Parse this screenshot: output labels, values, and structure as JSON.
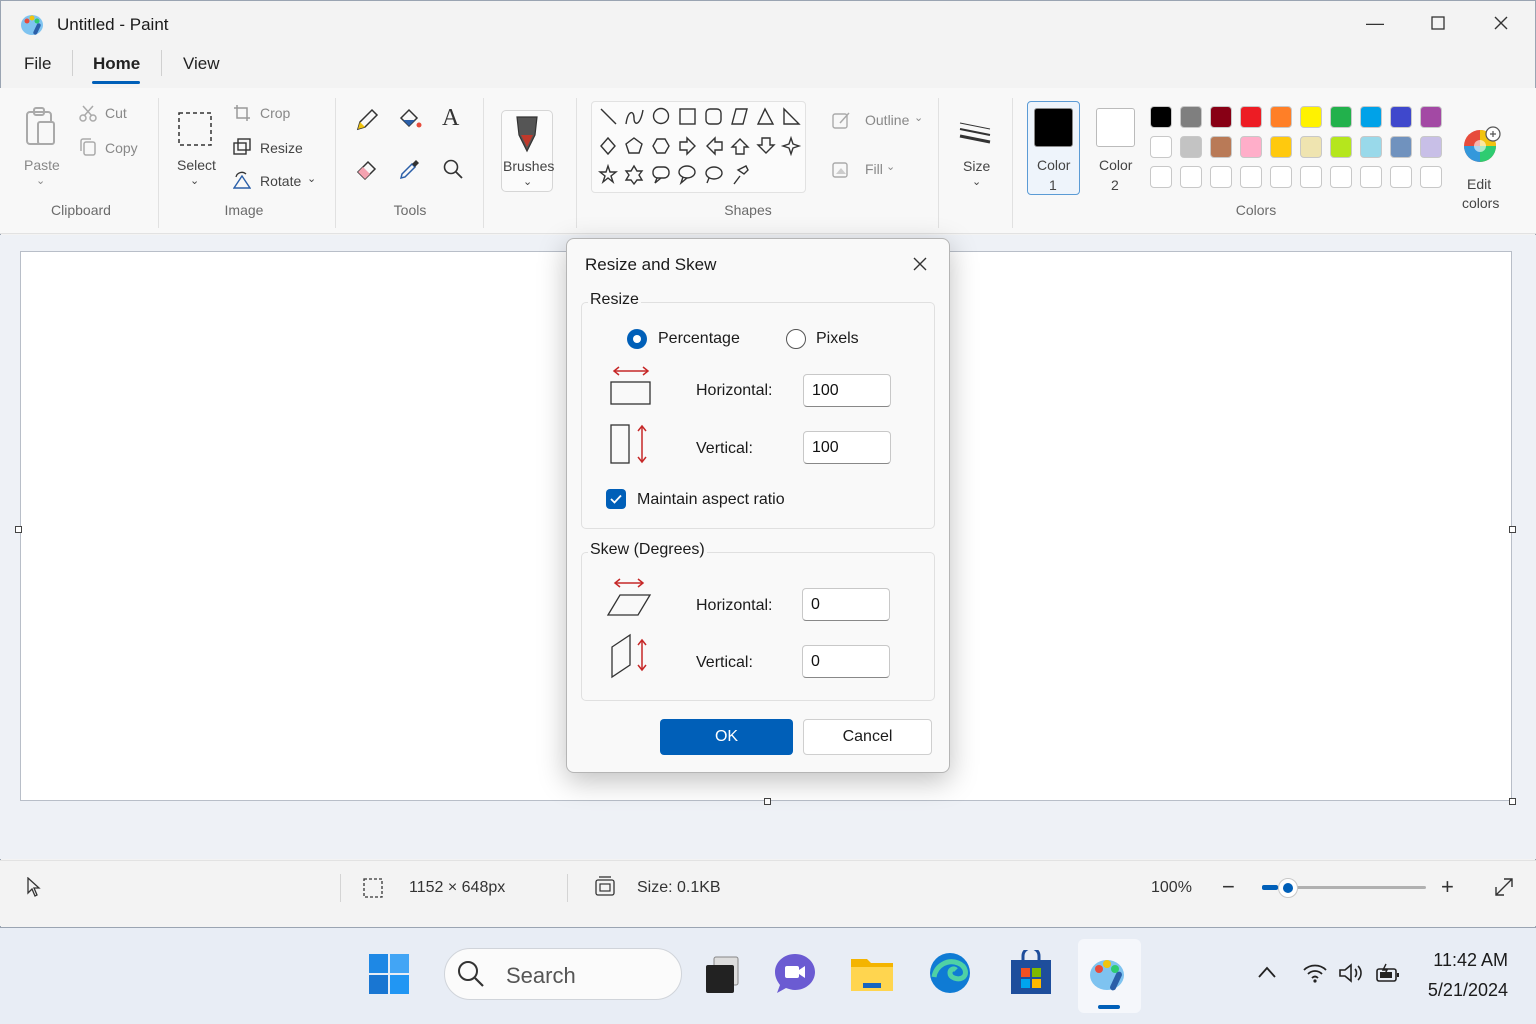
{
  "window": {
    "title": "Untitled - Paint",
    "icon": "paint-palette-icon",
    "controls": [
      "minimize-icon",
      "maximize-icon",
      "close-icon"
    ]
  },
  "menu": {
    "items": [
      "File",
      "Home",
      "View"
    ],
    "active": "Home"
  },
  "ribbon": {
    "clipboard": {
      "group_label": "Clipboard",
      "paste": "Paste",
      "cut": "Cut",
      "copy": "Copy"
    },
    "image": {
      "group_label": "Image",
      "select": "Select",
      "crop": "Crop",
      "resize": "Resize",
      "rotate": "Rotate"
    },
    "tools": {
      "group_label": "Tools"
    },
    "brushes": {
      "label": "Brushes"
    },
    "shapes": {
      "group_label": "Shapes",
      "outline": "Outline",
      "fill": "Fill"
    },
    "size": {
      "label": "Size"
    },
    "colors": {
      "group_label": "Colors",
      "color1": {
        "label": "Color",
        "num": "1",
        "value": "#000000"
      },
      "color2": {
        "label": "Color",
        "num": "2",
        "value": "#ffffff"
      },
      "edit": {
        "line1": "Edit",
        "line2": "colors"
      },
      "palette_row1": [
        "#000000",
        "#7f7f7f",
        "#880015",
        "#ed1c24",
        "#ff7f27",
        "#fff200",
        "#22b14c",
        "#00a2e8",
        "#3f48cc",
        "#a349a4"
      ],
      "palette_row2": [
        "#ffffff",
        "#c3c3c3",
        "#b97a57",
        "#ffaec9",
        "#ffc90e",
        "#efe4b0",
        "#b5e61d",
        "#99d9ea",
        "#7092be",
        "#c8bfe7"
      ],
      "palette_row3": [
        "#ffffff",
        "#ffffff",
        "#ffffff",
        "#ffffff",
        "#ffffff",
        "#ffffff",
        "#ffffff",
        "#ffffff",
        "#ffffff",
        "#ffffff"
      ]
    }
  },
  "dialog": {
    "title": "Resize and Skew",
    "resize": {
      "legend": "Resize",
      "mode_percentage": "Percentage",
      "mode_pixels": "Pixels",
      "selected_mode": "Percentage",
      "horizontal_label": "Horizontal:",
      "horizontal_value": "100",
      "vertical_label": "Vertical:",
      "vertical_value": "100",
      "aspect_label": "Maintain aspect ratio",
      "aspect_checked": true
    },
    "skew": {
      "legend": "Skew (Degrees)",
      "horizontal_label": "Horizontal:",
      "horizontal_value": "0",
      "vertical_label": "Vertical:",
      "vertical_value": "0"
    },
    "ok": "OK",
    "cancel": "Cancel"
  },
  "status": {
    "dimensions": "1152 × 648px",
    "size": "Size: 0.1KB",
    "zoom": "100%",
    "zoom_level": 0.1
  },
  "taskbar": {
    "search_placeholder": "Search",
    "time": "11:42 AM",
    "date": "5/21/2024",
    "apps": [
      "windows-start-icon",
      "task-view-icon",
      "teams-chat-icon",
      "file-explorer-icon",
      "edge-icon",
      "store-icon",
      "paint-icon"
    ]
  }
}
